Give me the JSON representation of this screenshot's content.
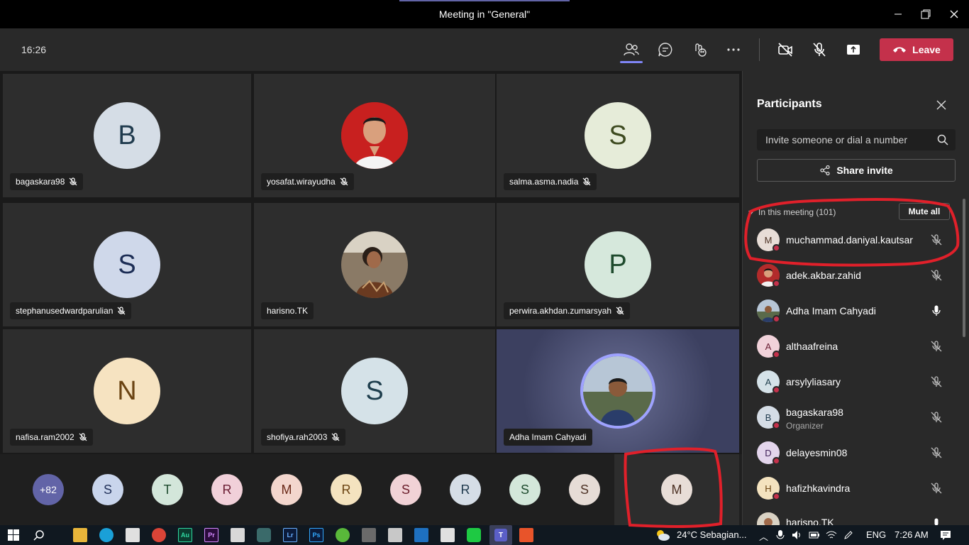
{
  "window": {
    "title": "Meeting in \"General\""
  },
  "toolbar": {
    "time": "16:26",
    "leave_label": "Leave"
  },
  "grid_tiles": [
    {
      "name": "bagaskara98",
      "initial": "B",
      "bg": "#d5dde6",
      "fg": "#1f3a4d",
      "muted": true
    },
    {
      "name": "yosafat.wirayudha",
      "initial": "",
      "bg": "#c8201f",
      "fg": "#fff",
      "muted": true,
      "photo": true
    },
    {
      "name": "salma.asma.nadia",
      "initial": "S",
      "bg": "#e6ecd9",
      "fg": "#3d4a1f",
      "muted": true
    },
    {
      "name": "stephanusedwardparulian",
      "initial": "S",
      "bg": "#cfd8ea",
      "fg": "#1c2d55",
      "muted": true
    },
    {
      "name": "harisno.TK",
      "initial": "",
      "bg": "#6b5a45",
      "fg": "#fff",
      "muted": false,
      "photo": true
    },
    {
      "name": "perwira.akhdan.zumarsyah",
      "initial": "P",
      "bg": "#d6e8dc",
      "fg": "#1e4a2d",
      "muted": true
    },
    {
      "name": "nafisa.ram2002",
      "initial": "N",
      "bg": "#f6e3c1",
      "fg": "#6b4413",
      "muted": true
    },
    {
      "name": "shofiya.rah2003",
      "initial": "S",
      "bg": "#d5e2e8",
      "fg": "#1e3e4d",
      "muted": true
    },
    {
      "name": "Adha Imam Cahyadi",
      "initial": "",
      "bg": "#3c4a6d",
      "fg": "#fff",
      "muted": false,
      "photo": true,
      "speaking": true
    }
  ],
  "stripe": {
    "overflow": "+82",
    "avatars": [
      {
        "initial": "S",
        "bg": "#c9d5ec",
        "fg": "#22315a"
      },
      {
        "initial": "T",
        "bg": "#d3e6da",
        "fg": "#1e4a2d"
      },
      {
        "initial": "R",
        "bg": "#f1d0d9",
        "fg": "#6a1d33"
      },
      {
        "initial": "M",
        "bg": "#f3d6cd",
        "fg": "#6a2918"
      },
      {
        "initial": "R",
        "bg": "#f4e3bf",
        "fg": "#6b4413"
      },
      {
        "initial": "S",
        "bg": "#f1d2d6",
        "fg": "#6a1d2a"
      },
      {
        "initial": "R",
        "bg": "#d5dde6",
        "fg": "#1f3a4d"
      },
      {
        "initial": "S",
        "bg": "#d3e7da",
        "fg": "#1e4a2d"
      },
      {
        "initial": "S",
        "bg": "#e6dcd6",
        "fg": "#4d3225"
      }
    ],
    "self": {
      "initial": "M",
      "bg": "#e8ddd7",
      "fg": "#4d3225"
    }
  },
  "panel": {
    "title": "Participants",
    "invite_placeholder": "Invite someone or dial a number",
    "share_label": "Share invite",
    "section_label": "In this meeting (101)",
    "mute_all_label": "Mute all",
    "participants": [
      {
        "name": "muchammad.daniyal.kautsar",
        "initial": "M",
        "bg": "#e8ddd7",
        "fg": "#4d3225",
        "mic": "muted"
      },
      {
        "name": "adek.akbar.zahid",
        "initial": "",
        "bg": "#b22b2b",
        "fg": "#fff",
        "mic": "muted",
        "photo": true
      },
      {
        "name": "Adha Imam Cahyadi",
        "initial": "",
        "bg": "#4a5a70",
        "fg": "#fff",
        "mic": "on",
        "photo": true
      },
      {
        "name": "althaafreina",
        "initial": "A",
        "bg": "#f1d2da",
        "fg": "#6a1d33",
        "mic": "muted"
      },
      {
        "name": "arsylyliasary",
        "initial": "A",
        "bg": "#d5e2e8",
        "fg": "#1e3e4d",
        "mic": "muted"
      },
      {
        "name": "bagaskara98",
        "role": "Organizer",
        "initial": "B",
        "bg": "#d5dde6",
        "fg": "#1f3a4d",
        "mic": "muted"
      },
      {
        "name": "delayesmin08",
        "initial": "D",
        "bg": "#e3d5ec",
        "fg": "#42225a",
        "mic": "muted"
      },
      {
        "name": "hafizhkavindra",
        "initial": "H",
        "bg": "#f4e3bf",
        "fg": "#6b4413",
        "mic": "muted"
      },
      {
        "name": "harisno.TK",
        "initial": "",
        "bg": "#6b5a45",
        "fg": "#fff",
        "mic": "on",
        "photo": true
      }
    ]
  },
  "taskbar": {
    "weather": "24°C  Sebagian...",
    "lang": "ENG",
    "time": "7:26 AM"
  }
}
